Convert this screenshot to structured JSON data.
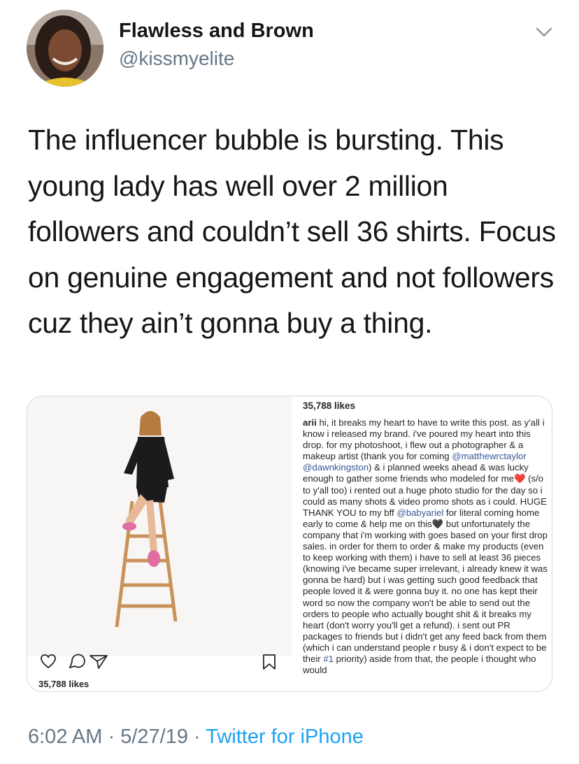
{
  "user": {
    "name": "Flawless and Brown",
    "handle": "@kissmyelite"
  },
  "tweet": {
    "text": "The influencer bubble is bursting. This young lady has well over 2 million followers and couldn’t sell 36 shirts. Focus on genuine engagement and not followers cuz they ain’t gonna buy a thing."
  },
  "embedded_post": {
    "likes_left": "35,788 likes",
    "likes_right": "35,788 likes",
    "username": "arii",
    "caption_1": " hi, it breaks my heart to have to write this post. as y'all i know i released my brand. i've poured my heart into this drop. for my photoshoot, i flew out a photographer & a makeup artist (thank you for coming ",
    "mention_1": "@matthewrctaylor",
    "caption_2": " ",
    "mention_2": "@dawnkingston",
    "caption_3": ") & i planned weeks ahead & was lucky enough to gather some friends who modeled for me",
    "heart_1": "❤️",
    "caption_4": " (s/o to y'all too) i rented out a huge photo studio for the day so i could as many shots & video promo shots as i could. HUGE THANK YOU to my bff ",
    "mention_3": "@babyariel",
    "caption_5": " for literal coming home early to come & help me on this",
    "heart_2": "🖤",
    "caption_6": " but unfortunately the company that i'm working with goes based on your first drop sales. in order for them to order & make my products (even to keep working with them) i have to sell at least 36 pieces (knowing i've became super irrelevant, i already knew it was gonna be hard) but i was getting such good feedback that people loved it & were gonna buy it. no one has kept their word so now the company won't be able to send out the orders to people who actually bought shit & it breaks my heart (don't worry you'll get a refund). i sent out PR packages to friends but i didn't get any feed back from them (which i can understand people r busy & i don't expect to be their ",
    "hashtag": "#1",
    "caption_7": " priority) aside from that, the people i thought who would"
  },
  "meta": {
    "time": "6:02 AM",
    "sep1": " · ",
    "date": "5/27/19",
    "sep2": " · ",
    "source": "Twitter for iPhone"
  },
  "icons": [
    "avatar",
    "chevron-down-icon",
    "heart-icon",
    "comment-icon",
    "share-icon",
    "bookmark-icon"
  ]
}
